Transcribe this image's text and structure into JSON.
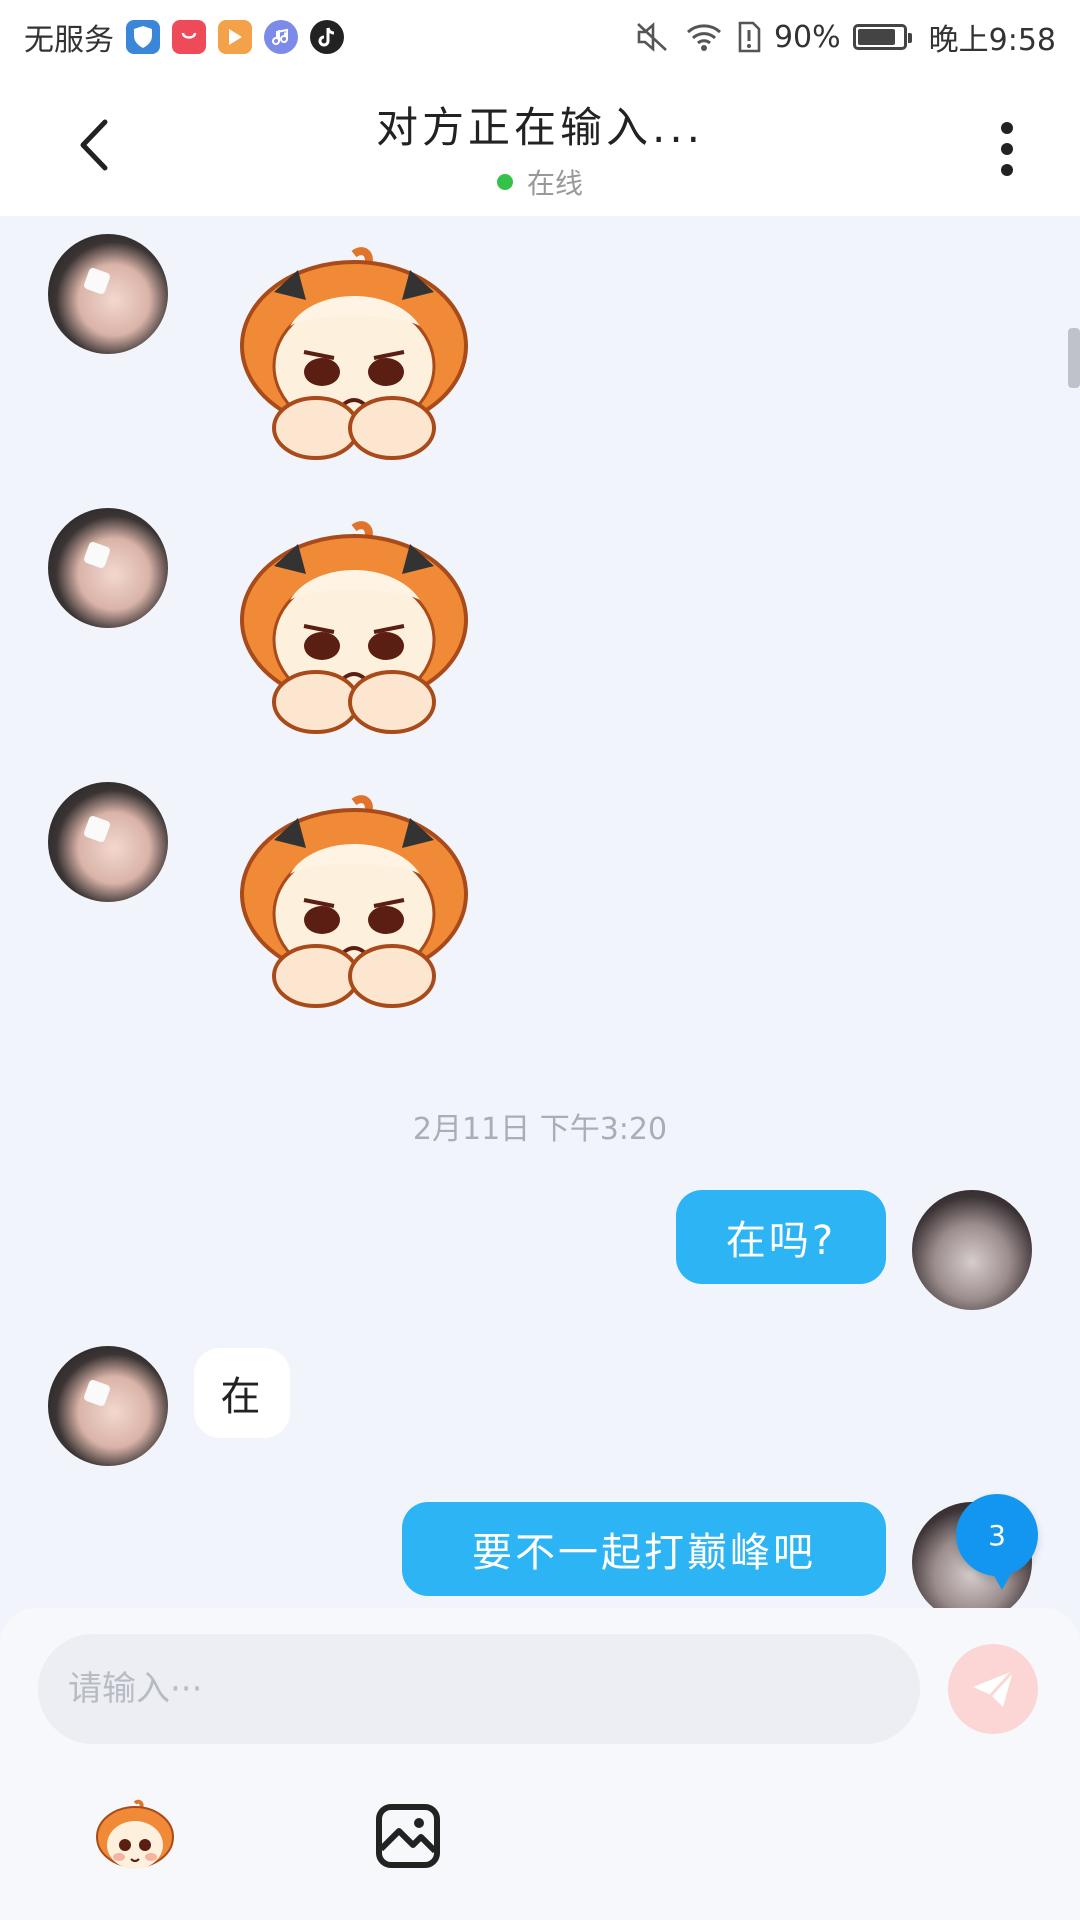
{
  "status_bar": {
    "carrier": "无服务",
    "battery_percent": "90%",
    "battery_level": 0.9,
    "time": "晚上9:58",
    "app_icons": [
      "shield-app-icon",
      "huawei-appgallery-icon",
      "video-app-icon",
      "music-app-icon",
      "tiktok-icon"
    ],
    "status_icons": [
      "mute-icon",
      "wifi-icon",
      "sim-alert-icon",
      "battery-icon"
    ]
  },
  "header": {
    "title": "对方正在输入...",
    "status": "在线"
  },
  "chat": {
    "messages": [
      {
        "from": "other",
        "type": "sticker",
        "icon": "sad-cartoon-sticker"
      },
      {
        "from": "other",
        "type": "sticker",
        "icon": "sad-cartoon-sticker"
      },
      {
        "from": "other",
        "type": "sticker",
        "icon": "sad-cartoon-sticker"
      },
      {
        "type": "timestamp",
        "text": "2月11日  下午3:20"
      },
      {
        "from": "self",
        "type": "text",
        "text": "在吗?"
      },
      {
        "from": "other",
        "type": "text",
        "text": "在"
      },
      {
        "from": "self",
        "type": "text",
        "text": "要不一起打巅峰吧"
      }
    ],
    "unread_badge": "3"
  },
  "input_panel": {
    "placeholder": "请输入···",
    "tools": [
      "sticker-picker-icon",
      "image-picker-icon"
    ]
  },
  "colors": {
    "self_bubble": "#2db4f5",
    "other_bubble": "#ffffff",
    "background": "#f1f4fa",
    "online": "#35c24a",
    "badge": "#1296f0",
    "send_button": "#fbd6d5"
  }
}
